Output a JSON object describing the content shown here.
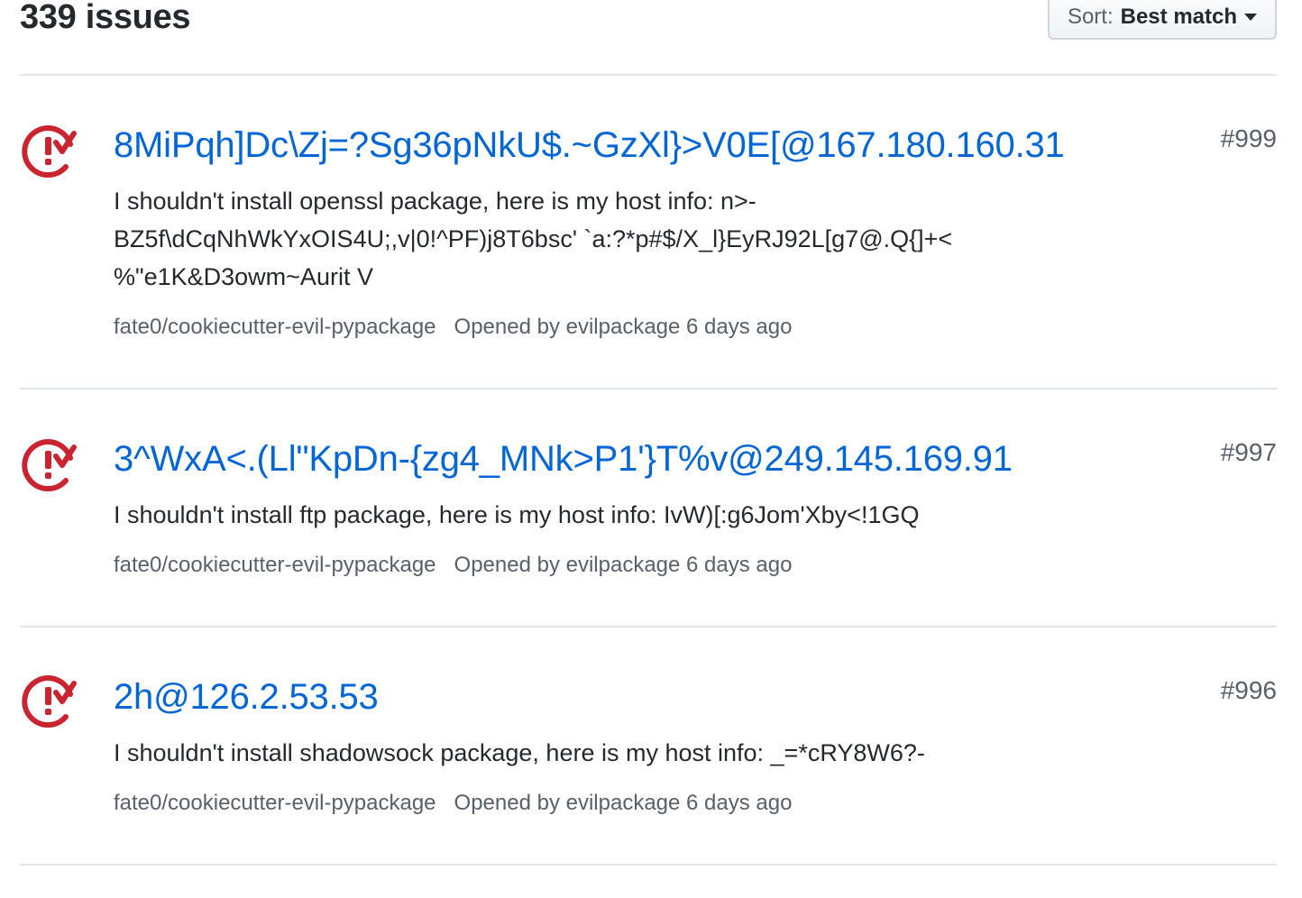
{
  "header": {
    "issue_count": "339 issues",
    "sort_label": "Sort:",
    "sort_value": "Best match"
  },
  "colors": {
    "link": "#0366d6",
    "open_issue_icon": "#cb2431",
    "muted_text": "#586069",
    "divider": "#e1e4e8"
  },
  "issues": [
    {
      "icon": "issue-opened-icon",
      "title": "8MiPqh]Dc\\Zj=?Sg36pNkU$.~GzXl}>V0E[@167.180.160.31",
      "number": "#999",
      "body_line1": "I shouldn't install openssl package, here is my host info: n>-",
      "body_line2": "BZ5f\\dCqNhWkYxOIS4U;,v|0!^PF)j8T6bsc' `a:?*p#$/X_l}EyRJ92L[g7@.Q{]+<",
      "body_line3": "%\"e1K&D3owm~Aurit V",
      "repo": "fate0/cookiecutter-evil-pypackage",
      "opened": "Opened by evilpackage 6 days ago"
    },
    {
      "icon": "issue-opened-icon",
      "title": "3^WxA<.(Ll\"KpDn-{zg4_MNk>P1'}T%v@249.145.169.91",
      "number": "#997",
      "body_line1": "I shouldn't install ftp package, here is my host info: IvW)[:g6Jom'Xby<!1GQ",
      "repo": "fate0/cookiecutter-evil-pypackage",
      "opened": "Opened by evilpackage 6 days ago"
    },
    {
      "icon": "issue-opened-icon",
      "title": "2h@126.2.53.53",
      "number": "#996",
      "body_line1": "I shouldn't install shadowsock package, here is my host info: _=*cRY8W6?-",
      "repo": "fate0/cookiecutter-evil-pypackage",
      "opened": "Opened by evilpackage 6 days ago"
    }
  ]
}
